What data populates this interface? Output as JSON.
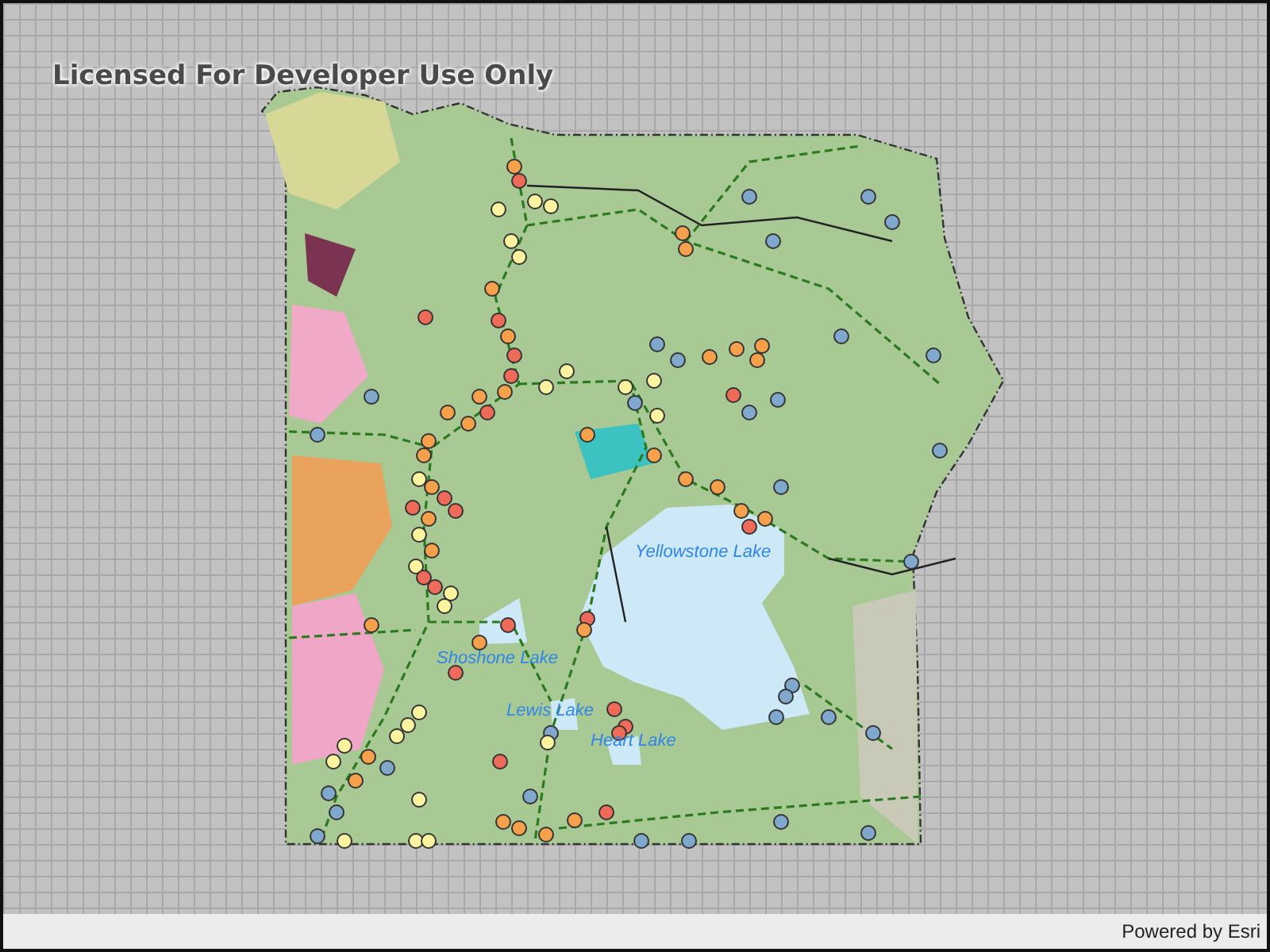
{
  "watermark": "Licensed For Developer Use Only",
  "map": {
    "labels": [
      {
        "text": "Yellowstone Lake"
      },
      {
        "text": "Shoshone Lake"
      },
      {
        "text": "Lewis Lake"
      },
      {
        "text": "Heart Lake"
      }
    ]
  },
  "attribution": "Powered by Esri"
}
